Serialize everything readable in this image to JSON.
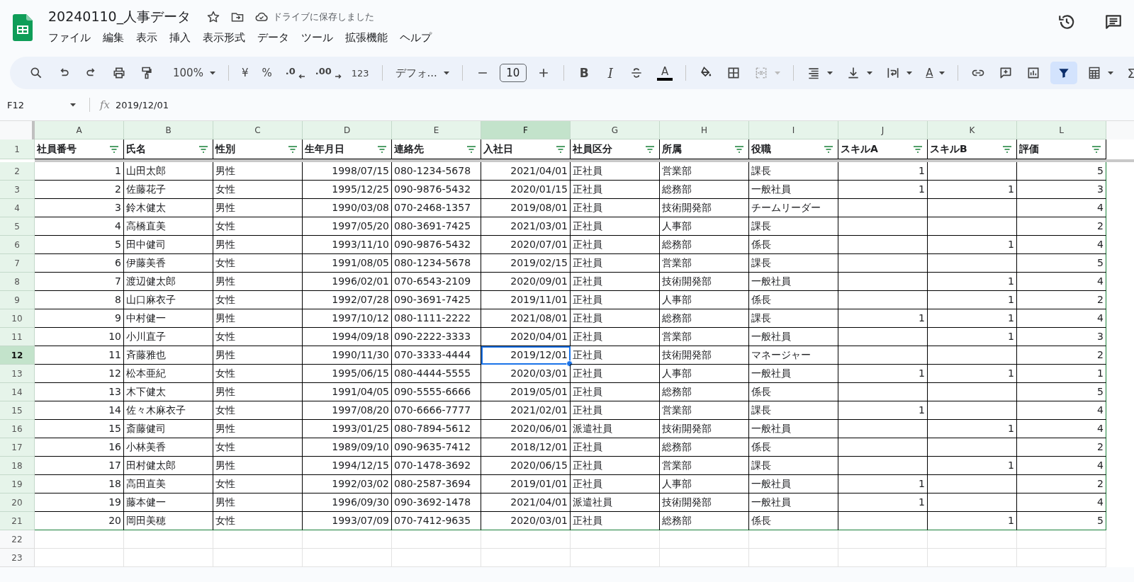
{
  "document": {
    "title": "20240110_人事データ",
    "save_status": "ドライブに保存しました"
  },
  "menu": [
    "ファイル",
    "編集",
    "表示",
    "挿入",
    "表示形式",
    "データ",
    "ツール",
    "拡張機能",
    "ヘルプ"
  ],
  "toolbar": {
    "zoom": "100%",
    "currency": "¥",
    "percent": "%",
    "decrease_decimal": ".0",
    "increase_decimal": ".00",
    "number_format": "123",
    "font": "デフォ...",
    "font_size": "10",
    "bold": "B",
    "italic": "I",
    "text_color": "A",
    "text_rotation": "A",
    "functions": "Σ",
    "filter_active": true
  },
  "formula_bar": {
    "name_box": "F12",
    "fx": "fx",
    "value": "2019/12/01"
  },
  "table": {
    "columns": [
      {
        "letter": "A",
        "header": "社員番号",
        "numeric": true,
        "selected": false
      },
      {
        "letter": "B",
        "header": "氏名",
        "numeric": false,
        "selected": false
      },
      {
        "letter": "C",
        "header": "性別",
        "numeric": false,
        "selected": false
      },
      {
        "letter": "D",
        "header": "生年月日",
        "numeric": true,
        "selected": false
      },
      {
        "letter": "E",
        "header": "連絡先",
        "numeric": false,
        "selected": false
      },
      {
        "letter": "F",
        "header": "入社日",
        "numeric": true,
        "selected": true
      },
      {
        "letter": "G",
        "header": "社員区分",
        "numeric": false,
        "selected": false
      },
      {
        "letter": "H",
        "header": "所属",
        "numeric": false,
        "selected": false
      },
      {
        "letter": "I",
        "header": "役職",
        "numeric": false,
        "selected": false
      },
      {
        "letter": "J",
        "header": "スキルA",
        "numeric": true,
        "selected": false
      },
      {
        "letter": "K",
        "header": "スキルB",
        "numeric": true,
        "selected": false
      },
      {
        "letter": "L",
        "header": "評価",
        "numeric": true,
        "selected": false
      }
    ],
    "header_row": "1",
    "rows": [
      {
        "num": "2",
        "selected": false,
        "cells": [
          "1",
          "山田太郎",
          "男性",
          "1998/07/15",
          "080-1234-5678",
          "2021/04/01",
          "正社員",
          "営業部",
          "課長",
          "1",
          null,
          "5"
        ]
      },
      {
        "num": "3",
        "selected": false,
        "cells": [
          "2",
          "佐藤花子",
          "女性",
          "1995/12/25",
          "090-9876-5432",
          "2020/01/15",
          "正社員",
          "総務部",
          "一般社員",
          "1",
          "1",
          "3"
        ]
      },
      {
        "num": "4",
        "selected": false,
        "cells": [
          "3",
          "鈴木健太",
          "男性",
          "1990/03/08",
          "070-2468-1357",
          "2019/08/01",
          "正社員",
          "技術開発部",
          "チームリーダー",
          null,
          null,
          "4"
        ]
      },
      {
        "num": "5",
        "selected": false,
        "cells": [
          "4",
          "高橋直美",
          "女性",
          "1997/05/20",
          "080-3691-7425",
          "2021/03/01",
          "正社員",
          "人事部",
          "課長",
          null,
          null,
          "2"
        ]
      },
      {
        "num": "6",
        "selected": false,
        "cells": [
          "5",
          "田中健司",
          "男性",
          "1993/11/10",
          "090-9876-5432",
          "2020/07/01",
          "正社員",
          "総務部",
          "係長",
          null,
          "1",
          "4"
        ]
      },
      {
        "num": "7",
        "selected": false,
        "cells": [
          "6",
          "伊藤美香",
          "女性",
          "1991/08/05",
          "080-1234-5678",
          "2019/02/15",
          "正社員",
          "営業部",
          "課長",
          null,
          null,
          "5"
        ]
      },
      {
        "num": "8",
        "selected": false,
        "cells": [
          "7",
          "渡辺健太郎",
          "男性",
          "1996/02/01",
          "070-6543-2109",
          "2020/09/01",
          "正社員",
          "技術開発部",
          "一般社員",
          null,
          "1",
          "4"
        ]
      },
      {
        "num": "9",
        "selected": false,
        "cells": [
          "8",
          "山口麻衣子",
          "女性",
          "1992/07/28",
          "090-3691-7425",
          "2019/11/01",
          "正社員",
          "人事部",
          "係長",
          null,
          "1",
          "2"
        ]
      },
      {
        "num": "10",
        "selected": false,
        "cells": [
          "9",
          "中村健一",
          "男性",
          "1997/10/12",
          "080-1111-2222",
          "2021/08/01",
          "正社員",
          "総務部",
          "課長",
          "1",
          "1",
          "4"
        ]
      },
      {
        "num": "11",
        "selected": false,
        "cells": [
          "10",
          "小川直子",
          "女性",
          "1994/09/18",
          "090-2222-3333",
          "2020/04/01",
          "正社員",
          "営業部",
          "一般社員",
          null,
          "1",
          "3"
        ]
      },
      {
        "num": "12",
        "selected": true,
        "cells": [
          "11",
          "斉藤雅也",
          "男性",
          "1990/11/30",
          "070-3333-4444",
          "2019/12/01",
          "正社員",
          "技術開発部",
          "マネージャー",
          null,
          null,
          "2"
        ]
      },
      {
        "num": "13",
        "selected": false,
        "cells": [
          "12",
          "松本亜紀",
          "女性",
          "1995/06/15",
          "080-4444-5555",
          "2020/03/01",
          "正社員",
          "人事部",
          "一般社員",
          "1",
          "1",
          "1"
        ]
      },
      {
        "num": "14",
        "selected": false,
        "cells": [
          "13",
          "木下健太",
          "男性",
          "1991/04/05",
          "090-5555-6666",
          "2019/05/01",
          "正社員",
          "総務部",
          "係長",
          null,
          null,
          "5"
        ]
      },
      {
        "num": "15",
        "selected": false,
        "cells": [
          "14",
          "佐々木麻衣子",
          "女性",
          "1997/08/20",
          "070-6666-7777",
          "2021/02/01",
          "正社員",
          "営業部",
          "課長",
          "1",
          null,
          "4"
        ]
      },
      {
        "num": "16",
        "selected": false,
        "cells": [
          "15",
          "斎藤健司",
          "男性",
          "1993/01/25",
          "080-7894-5612",
          "2020/06/01",
          "派遣社員",
          "技術開発部",
          "一般社員",
          null,
          "1",
          "4"
        ]
      },
      {
        "num": "17",
        "selected": false,
        "cells": [
          "16",
          "小林美香",
          "女性",
          "1989/09/10",
          "090-9635-7412",
          "2018/12/01",
          "正社員",
          "総務部",
          "係長",
          null,
          null,
          "2"
        ]
      },
      {
        "num": "18",
        "selected": false,
        "cells": [
          "17",
          "田村健太郎",
          "男性",
          "1994/12/15",
          "070-1478-3692",
          "2020/06/15",
          "正社員",
          "営業部",
          "課長",
          null,
          "1",
          "4"
        ]
      },
      {
        "num": "19",
        "selected": false,
        "cells": [
          "18",
          "高田直美",
          "女性",
          "1992/03/02",
          "080-2587-3694",
          "2019/01/01",
          "正社員",
          "人事部",
          "一般社員",
          "1",
          null,
          "2"
        ]
      },
      {
        "num": "20",
        "selected": false,
        "cells": [
          "19",
          "藤本健一",
          "男性",
          "1996/09/30",
          "090-3692-1478",
          "2021/04/01",
          "派遣社員",
          "技術開発部",
          "一般社員",
          "1",
          null,
          "4"
        ]
      },
      {
        "num": "21",
        "selected": false,
        "cells": [
          "20",
          "岡田美穂",
          "女性",
          "1993/07/09",
          "070-7412-9635",
          "2020/03/01",
          "正社員",
          "総務部",
          "係長",
          null,
          "1",
          "5"
        ]
      }
    ],
    "empty_rows": [
      "22",
      "23"
    ]
  }
}
